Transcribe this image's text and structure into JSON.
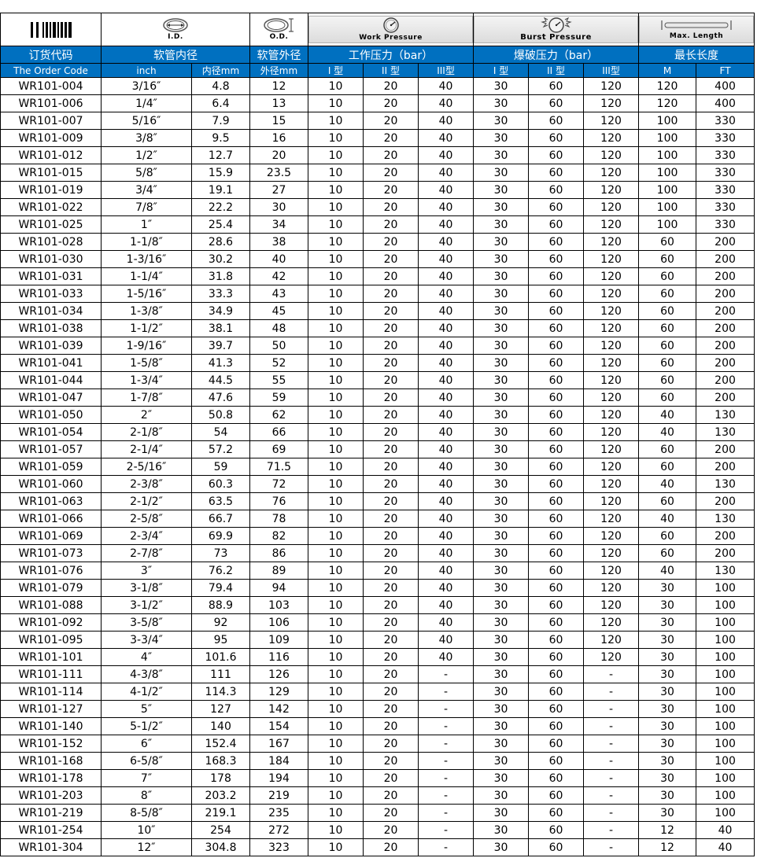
{
  "icon_labels": {
    "id": "I.D.",
    "od": "O.D.",
    "work": "Work Pressure",
    "burst": "Burst Pressure",
    "maxlen": "Max. Length"
  },
  "header": {
    "order_code_cn": "订货代码",
    "id_cn": "软管内径",
    "od_cn": "软管外径",
    "work_cn": "工作压力（bar）",
    "burst_cn": "爆破压力（bar）",
    "length_cn": "最长长度",
    "order_code_en": "The Order Code",
    "inch": "inch",
    "id_mm": "内径mm",
    "od_mm": "外径mm",
    "type1": "I 型",
    "type2": "II 型",
    "type3": "III型",
    "m": "M",
    "ft": "FT"
  },
  "rows": [
    {
      "code": "WR101-004",
      "inch": "3/16″",
      "id_mm": "4.8",
      "od_mm": "12",
      "w1": "10",
      "w2": "20",
      "w3": "40",
      "b1": "30",
      "b2": "60",
      "b3": "120",
      "m": "120",
      "ft": "400"
    },
    {
      "code": "WR101-006",
      "inch": "1/4″",
      "id_mm": "6.4",
      "od_mm": "13",
      "w1": "10",
      "w2": "20",
      "w3": "40",
      "b1": "30",
      "b2": "60",
      "b3": "120",
      "m": "120",
      "ft": "400"
    },
    {
      "code": "WR101-007",
      "inch": "5/16″",
      "id_mm": "7.9",
      "od_mm": "15",
      "w1": "10",
      "w2": "20",
      "w3": "40",
      "b1": "30",
      "b2": "60",
      "b3": "120",
      "m": "100",
      "ft": "330"
    },
    {
      "code": "WR101-009",
      "inch": "3/8″",
      "id_mm": "9.5",
      "od_mm": "16",
      "w1": "10",
      "w2": "20",
      "w3": "40",
      "b1": "30",
      "b2": "60",
      "b3": "120",
      "m": "100",
      "ft": "330"
    },
    {
      "code": "WR101-012",
      "inch": "1/2″",
      "id_mm": "12.7",
      "od_mm": "20",
      "w1": "10",
      "w2": "20",
      "w3": "40",
      "b1": "30",
      "b2": "60",
      "b3": "120",
      "m": "100",
      "ft": "330"
    },
    {
      "code": "WR101-015",
      "inch": "5/8″",
      "id_mm": "15.9",
      "od_mm": "23.5",
      "w1": "10",
      "w2": "20",
      "w3": "40",
      "b1": "30",
      "b2": "60",
      "b3": "120",
      "m": "100",
      "ft": "330"
    },
    {
      "code": "WR101-019",
      "inch": "3/4″",
      "id_mm": "19.1",
      "od_mm": "27",
      "w1": "10",
      "w2": "20",
      "w3": "40",
      "b1": "30",
      "b2": "60",
      "b3": "120",
      "m": "100",
      "ft": "330"
    },
    {
      "code": "WR101-022",
      "inch": "7/8″",
      "id_mm": "22.2",
      "od_mm": "30",
      "w1": "10",
      "w2": "20",
      "w3": "40",
      "b1": "30",
      "b2": "60",
      "b3": "120",
      "m": "100",
      "ft": "330"
    },
    {
      "code": "WR101-025",
      "inch": "1″",
      "id_mm": "25.4",
      "od_mm": "34",
      "w1": "10",
      "w2": "20",
      "w3": "40",
      "b1": "30",
      "b2": "60",
      "b3": "120",
      "m": "100",
      "ft": "330"
    },
    {
      "code": "WR101-028",
      "inch": "1-1/8″",
      "id_mm": "28.6",
      "od_mm": "38",
      "w1": "10",
      "w2": "20",
      "w3": "40",
      "b1": "30",
      "b2": "60",
      "b3": "120",
      "m": "60",
      "ft": "200"
    },
    {
      "code": "WR101-030",
      "inch": "1-3/16″",
      "id_mm": "30.2",
      "od_mm": "40",
      "w1": "10",
      "w2": "20",
      "w3": "40",
      "b1": "30",
      "b2": "60",
      "b3": "120",
      "m": "60",
      "ft": "200"
    },
    {
      "code": "WR101-031",
      "inch": "1-1/4″",
      "id_mm": "31.8",
      "od_mm": "42",
      "w1": "10",
      "w2": "20",
      "w3": "40",
      "b1": "30",
      "b2": "60",
      "b3": "120",
      "m": "60",
      "ft": "200"
    },
    {
      "code": "WR101-033",
      "inch": "1-5/16″",
      "id_mm": "33.3",
      "od_mm": "43",
      "w1": "10",
      "w2": "20",
      "w3": "40",
      "b1": "30",
      "b2": "60",
      "b3": "120",
      "m": "60",
      "ft": "200"
    },
    {
      "code": "WR101-034",
      "inch": "1-3/8″",
      "id_mm": "34.9",
      "od_mm": "45",
      "w1": "10",
      "w2": "20",
      "w3": "40",
      "b1": "30",
      "b2": "60",
      "b3": "120",
      "m": "60",
      "ft": "200"
    },
    {
      "code": "WR101-038",
      "inch": "1-1/2″",
      "id_mm": "38.1",
      "od_mm": "48",
      "w1": "10",
      "w2": "20",
      "w3": "40",
      "b1": "30",
      "b2": "60",
      "b3": "120",
      "m": "60",
      "ft": "200"
    },
    {
      "code": "WR101-039",
      "inch": "1-9/16″",
      "id_mm": "39.7",
      "od_mm": "50",
      "w1": "10",
      "w2": "20",
      "w3": "40",
      "b1": "30",
      "b2": "60",
      "b3": "120",
      "m": "60",
      "ft": "200"
    },
    {
      "code": "WR101-041",
      "inch": "1-5/8″",
      "id_mm": "41.3",
      "od_mm": "52",
      "w1": "10",
      "w2": "20",
      "w3": "40",
      "b1": "30",
      "b2": "60",
      "b3": "120",
      "m": "60",
      "ft": "200"
    },
    {
      "code": "WR101-044",
      "inch": "1-3/4″",
      "id_mm": "44.5",
      "od_mm": "55",
      "w1": "10",
      "w2": "20",
      "w3": "40",
      "b1": "30",
      "b2": "60",
      "b3": "120",
      "m": "60",
      "ft": "200"
    },
    {
      "code": "WR101-047",
      "inch": "1-7/8″",
      "id_mm": "47.6",
      "od_mm": "59",
      "w1": "10",
      "w2": "20",
      "w3": "40",
      "b1": "30",
      "b2": "60",
      "b3": "120",
      "m": "60",
      "ft": "200"
    },
    {
      "code": "WR101-050",
      "inch": "2″",
      "id_mm": "50.8",
      "od_mm": "62",
      "w1": "10",
      "w2": "20",
      "w3": "40",
      "b1": "30",
      "b2": "60",
      "b3": "120",
      "m": "40",
      "ft": "130"
    },
    {
      "code": "WR101-054",
      "inch": "2-1/8″",
      "id_mm": "54",
      "od_mm": "66",
      "w1": "10",
      "w2": "20",
      "w3": "40",
      "b1": "30",
      "b2": "60",
      "b3": "120",
      "m": "40",
      "ft": "130"
    },
    {
      "code": "WR101-057",
      "inch": "2-1/4″",
      "id_mm": "57.2",
      "od_mm": "69",
      "w1": "10",
      "w2": "20",
      "w3": "40",
      "b1": "30",
      "b2": "60",
      "b3": "120",
      "m": "60",
      "ft": "200"
    },
    {
      "code": "WR101-059",
      "inch": "2-5/16″",
      "id_mm": "59",
      "od_mm": "71.5",
      "w1": "10",
      "w2": "20",
      "w3": "40",
      "b1": "30",
      "b2": "60",
      "b3": "120",
      "m": "60",
      "ft": "200"
    },
    {
      "code": "WR101-060",
      "inch": "2-3/8″",
      "id_mm": "60.3",
      "od_mm": "72",
      "w1": "10",
      "w2": "20",
      "w3": "40",
      "b1": "30",
      "b2": "60",
      "b3": "120",
      "m": "40",
      "ft": "130"
    },
    {
      "code": "WR101-063",
      "inch": "2-1/2″",
      "id_mm": "63.5",
      "od_mm": "76",
      "w1": "10",
      "w2": "20",
      "w3": "40",
      "b1": "30",
      "b2": "60",
      "b3": "120",
      "m": "60",
      "ft": "200"
    },
    {
      "code": "WR101-066",
      "inch": "2-5/8″",
      "id_mm": "66.7",
      "od_mm": "78",
      "w1": "10",
      "w2": "20",
      "w3": "40",
      "b1": "30",
      "b2": "60",
      "b3": "120",
      "m": "40",
      "ft": "130"
    },
    {
      "code": "WR101-069",
      "inch": "2-3/4″",
      "id_mm": "69.9",
      "od_mm": "82",
      "w1": "10",
      "w2": "20",
      "w3": "40",
      "b1": "30",
      "b2": "60",
      "b3": "120",
      "m": "60",
      "ft": "200"
    },
    {
      "code": "WR101-073",
      "inch": "2-7/8″",
      "id_mm": "73",
      "od_mm": "86",
      "w1": "10",
      "w2": "20",
      "w3": "40",
      "b1": "30",
      "b2": "60",
      "b3": "120",
      "m": "60",
      "ft": "200"
    },
    {
      "code": "WR101-076",
      "inch": "3″",
      "id_mm": "76.2",
      "od_mm": "89",
      "w1": "10",
      "w2": "20",
      "w3": "40",
      "b1": "30",
      "b2": "60",
      "b3": "120",
      "m": "40",
      "ft": "130"
    },
    {
      "code": "WR101-079",
      "inch": "3-1/8″",
      "id_mm": "79.4",
      "od_mm": "94",
      "w1": "10",
      "w2": "20",
      "w3": "40",
      "b1": "30",
      "b2": "60",
      "b3": "120",
      "m": "30",
      "ft": "100"
    },
    {
      "code": "WR101-088",
      "inch": "3-1/2″",
      "id_mm": "88.9",
      "od_mm": "103",
      "w1": "10",
      "w2": "20",
      "w3": "40",
      "b1": "30",
      "b2": "60",
      "b3": "120",
      "m": "30",
      "ft": "100"
    },
    {
      "code": "WR101-092",
      "inch": "3-5/8″",
      "id_mm": "92",
      "od_mm": "106",
      "w1": "10",
      "w2": "20",
      "w3": "40",
      "b1": "30",
      "b2": "60",
      "b3": "120",
      "m": "30",
      "ft": "100"
    },
    {
      "code": "WR101-095",
      "inch": "3-3/4″",
      "id_mm": "95",
      "od_mm": "109",
      "w1": "10",
      "w2": "20",
      "w3": "40",
      "b1": "30",
      "b2": "60",
      "b3": "120",
      "m": "30",
      "ft": "100"
    },
    {
      "code": "WR101-101",
      "inch": "4″",
      "id_mm": "101.6",
      "od_mm": "116",
      "w1": "10",
      "w2": "20",
      "w3": "40",
      "b1": "30",
      "b2": "60",
      "b3": "120",
      "m": "30",
      "ft": "100"
    },
    {
      "code": "WR101-111",
      "inch": "4-3/8″",
      "id_mm": "111",
      "od_mm": "126",
      "w1": "10",
      "w2": "20",
      "w3": "-",
      "b1": "30",
      "b2": "60",
      "b3": "-",
      "m": "30",
      "ft": "100"
    },
    {
      "code": "WR101-114",
      "inch": "4-1/2″",
      "id_mm": "114.3",
      "od_mm": "129",
      "w1": "10",
      "w2": "20",
      "w3": "-",
      "b1": "30",
      "b2": "60",
      "b3": "-",
      "m": "30",
      "ft": "100"
    },
    {
      "code": "WR101-127",
      "inch": "5″",
      "id_mm": "127",
      "od_mm": "142",
      "w1": "10",
      "w2": "20",
      "w3": "-",
      "b1": "30",
      "b2": "60",
      "b3": "-",
      "m": "30",
      "ft": "100"
    },
    {
      "code": "WR101-140",
      "inch": "5-1/2″",
      "id_mm": "140",
      "od_mm": "154",
      "w1": "10",
      "w2": "20",
      "w3": "-",
      "b1": "30",
      "b2": "60",
      "b3": "-",
      "m": "30",
      "ft": "100"
    },
    {
      "code": "WR101-152",
      "inch": "6″",
      "id_mm": "152.4",
      "od_mm": "167",
      "w1": "10",
      "w2": "20",
      "w3": "-",
      "b1": "30",
      "b2": "60",
      "b3": "-",
      "m": "30",
      "ft": "100"
    },
    {
      "code": "WR101-168",
      "inch": "6-5/8″",
      "id_mm": "168.3",
      "od_mm": "184",
      "w1": "10",
      "w2": "20",
      "w3": "-",
      "b1": "30",
      "b2": "60",
      "b3": "-",
      "m": "30",
      "ft": "100"
    },
    {
      "code": "WR101-178",
      "inch": "7″",
      "id_mm": "178",
      "od_mm": "194",
      "w1": "10",
      "w2": "20",
      "w3": "-",
      "b1": "30",
      "b2": "60",
      "b3": "-",
      "m": "30",
      "ft": "100"
    },
    {
      "code": "WR101-203",
      "inch": "8″",
      "id_mm": "203.2",
      "od_mm": "219",
      "w1": "10",
      "w2": "20",
      "w3": "-",
      "b1": "30",
      "b2": "60",
      "b3": "-",
      "m": "30",
      "ft": "100"
    },
    {
      "code": "WR101-219",
      "inch": "8-5/8″",
      "id_mm": "219.1",
      "od_mm": "235",
      "w1": "10",
      "w2": "20",
      "w3": "-",
      "b1": "30",
      "b2": "60",
      "b3": "-",
      "m": "30",
      "ft": "100"
    },
    {
      "code": "WR101-254",
      "inch": "10″",
      "id_mm": "254",
      "od_mm": "272",
      "w1": "10",
      "w2": "20",
      "w3": "-",
      "b1": "30",
      "b2": "60",
      "b3": "-",
      "m": "12",
      "ft": "40"
    },
    {
      "code": "WR101-304",
      "inch": "12″",
      "id_mm": "304.8",
      "od_mm": "323",
      "w1": "10",
      "w2": "20",
      "w3": "-",
      "b1": "30",
      "b2": "60",
      "b3": "-",
      "m": "12",
      "ft": "40"
    }
  ]
}
